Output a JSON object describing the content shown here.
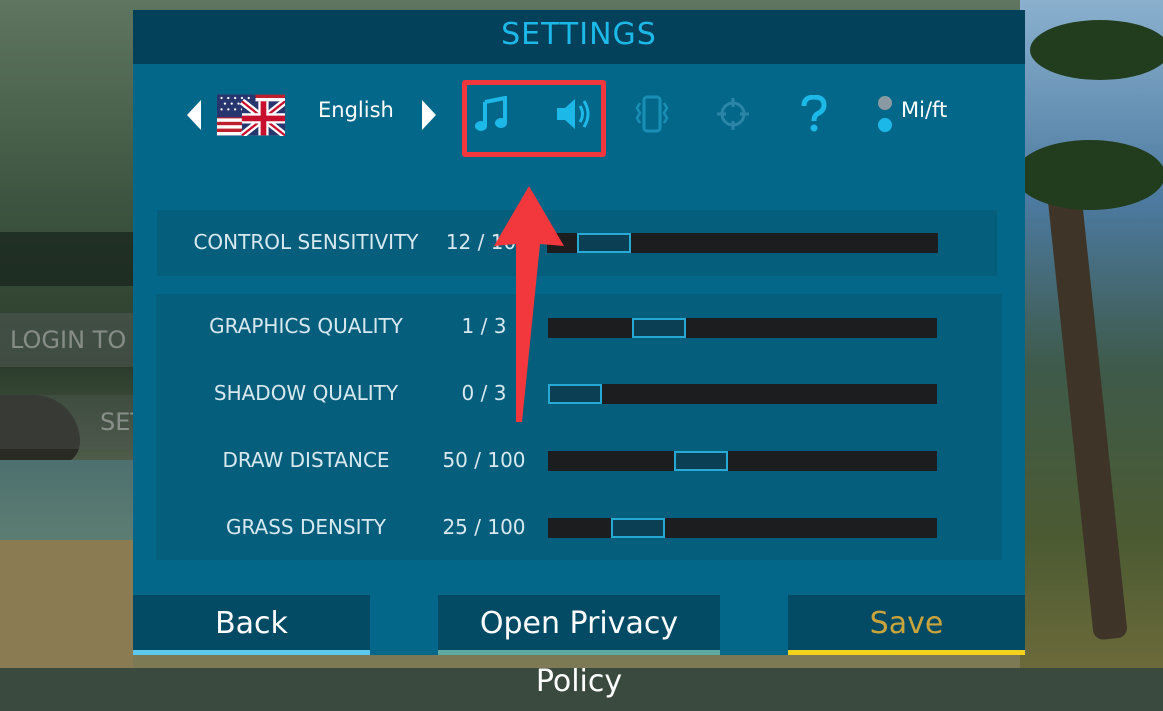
{
  "background": {
    "left_menu": [
      "LOGIN TO",
      "SET"
    ]
  },
  "dialog": {
    "title": "SETTINGS",
    "language": {
      "label": "English",
      "flag_icon": "uk-flag-icon"
    },
    "tab_icons": [
      {
        "name": "music-icon",
        "glyph": "♫",
        "color": "#1cb8e8"
      },
      {
        "name": "sound-icon",
        "glyph": "speaker",
        "color": "#1cb8e8"
      },
      {
        "name": "vibration-icon",
        "glyph": "vibrate",
        "color": "#1a8fb6"
      },
      {
        "name": "crosshair-icon",
        "glyph": "target",
        "color": "#2c85a6"
      },
      {
        "name": "help-icon",
        "glyph": "?",
        "color": "#1cb8e8"
      }
    ],
    "units_label": "Mi/ft",
    "sliders": [
      {
        "label": "CONTROL SENSITIVITY",
        "value_text": "12 / 10",
        "value": 12,
        "max": 100
      },
      {
        "label": "GRAPHICS QUALITY",
        "value_text": "1 / 3",
        "value": 1,
        "max": 3
      },
      {
        "label": "SHADOW QUALITY",
        "value_text": "0 / 3",
        "value": 0,
        "max": 3
      },
      {
        "label": "DRAW DISTANCE",
        "value_text": "50 / 100",
        "value": 50,
        "max": 100
      },
      {
        "label": "GRASS DENSITY",
        "value_text": "25 / 100",
        "value": 25,
        "max": 100
      }
    ],
    "buttons": {
      "back": "Back",
      "privacy": "Open Privacy Policy",
      "save": "Save"
    },
    "colors": {
      "title": "#1cb8e8",
      "back_bar": "#5cc8ec",
      "privacy_bar": "#5fa9a3",
      "save_bar": "#f2d21c",
      "save_text": "#c9a43a",
      "annotation": "#f2383d"
    }
  }
}
